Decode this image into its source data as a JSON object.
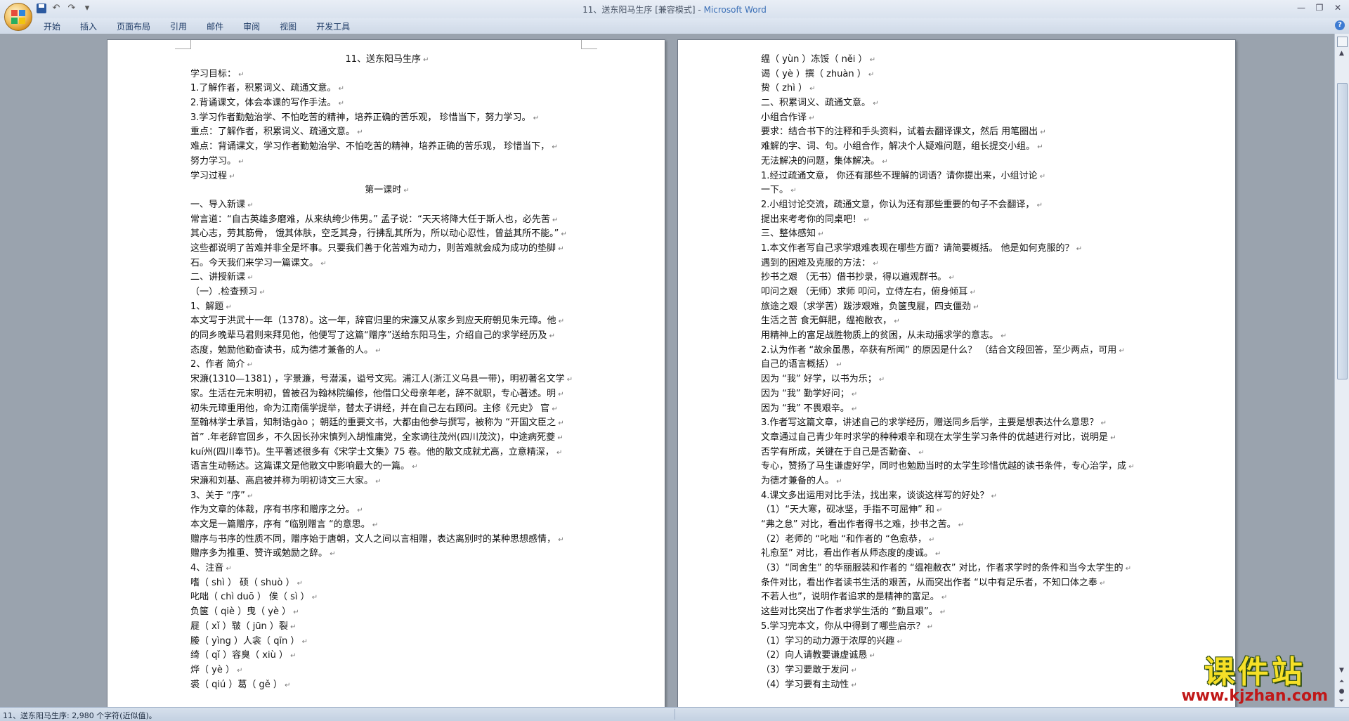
{
  "window": {
    "doc_title": "11、送东阳马生序 [兼容模式]",
    "separator": " - ",
    "app_name": "Microsoft Word"
  },
  "ribbon": {
    "tabs": [
      "开始",
      "插入",
      "页面布局",
      "引用",
      "邮件",
      "审阅",
      "视图",
      "开发工具"
    ]
  },
  "left_page": {
    "lines": [
      {
        "text": "11、送东阳马生序",
        "center": true
      },
      {
        "text": "学习目标："
      },
      {
        "text": "1.了解作者，积累词义、疏通文意。"
      },
      {
        "text": "2.背诵课文，体会本课的写作手法。"
      },
      {
        "text": "3.学习作者勤勉治学、不怕吃苦的精神，培养正确的苦乐观， 珍惜当下，努力学习。"
      },
      {
        "text": "重点：了解作者，积累词义、疏通文意。"
      },
      {
        "text": "难点：背诵课文，学习作者勤勉治学、不怕吃苦的精神，培养正确的苦乐观， 珍惜当下，"
      },
      {
        "text": "努力学习。"
      },
      {
        "text": "学习过程"
      },
      {
        "text": "第一课时",
        "center": true
      },
      {
        "text": "一、导入新课"
      },
      {
        "text": "常言道：“自古英雄多磨难，从来纨绔少伟男。” 孟子说：“天天将降大任于斯人也，必先苦"
      },
      {
        "text": "其心志，劳其筋骨，  饿其体肤，空乏其身，行拂乱其所为，所以动心忍性，曾益其所不能。”"
      },
      {
        "text": "这些都说明了苦难并非全是坏事。只要我们善于化苦难为动力，则苦难就会成为成功的垫脚"
      },
      {
        "text": "石。今天我们来学习一篇课文。"
      },
      {
        "text": "二、讲授新课"
      },
      {
        "text": "（一）.检查预习"
      },
      {
        "text": "1、解题"
      },
      {
        "text": "本文写于洪武十一年（1378）。这一年，辞官归里的宋濂又从家乡到应天府朝见朱元璋。他"
      },
      {
        "text": "的同乡晚辈马君则来拜见他，他便写了这篇“赠序”送给东阳马生，介绍自己的求学经历及"
      },
      {
        "text": "态度，勉励他勤奋读书，成为德才兼备的人。"
      },
      {
        "text": "2、作者 简介"
      },
      {
        "text": "宋濂(1310—1381) ，字景濂，号潜溪，谥号文宪。浦江人(浙江义乌县一带)，明初著名文学"
      },
      {
        "text": "家。生活在元末明初，曾被召为翰林院编修，他借口父母亲年老，辞不就职，专心著述。明"
      },
      {
        "text": "初朱元璋重用他，命为江南儒学提举，替太子讲经，并在自己左右顾问。主修《元史》 官"
      },
      {
        "text": "至翰林学士承旨，知制诰ɡào ；朝廷的重要文书，大都由他参与撰写，被称为 “开国文臣之"
      },
      {
        "text": "首” .年老辞官回乡，不久因长孙宋慎列入胡惟庸党，全家谪往茂州(四川茂汶)，中途病死夔"
      },
      {
        "text": "kuí州(四川奉节)。生平著述很多有《宋学士文集》75 卷。他的散文成就尤高，立意精深，"
      },
      {
        "text": "语言生动畅达。这篇课文是他散文中影响最大的一篇。"
      },
      {
        "text": "宋濂和刘基、高启被并称为明初诗文三大家。"
      },
      {
        "text": "3、关于 “序”"
      },
      {
        "text": "作为文章的体裁，序有书序和赠序之分。"
      },
      {
        "text": "本文是一篇赠序，序有 “临别赠言 “的意思。"
      },
      {
        "text": "赠序与书序的性质不同，赠序始于唐朝，文人之间以言相赠，表达离别时的某种思想感情，"
      },
      {
        "text": "赠序多为推重、赞许或勉励之辞。"
      },
      {
        "text": "4、注音"
      },
      {
        "text": "嗜（    shì  ）         硕（     shuò  ）"
      },
      {
        "text": "叱咄（   chì  duō  ）     俟（   sì  ）"
      },
      {
        "text": "负箧（  qiè ）曳（   yè   ）"
      },
      {
        "text": "屣（    xǐ  ）皲（ jūn ）裂"
      },
      {
        "text": " 媵（     yìng ）人衾（  qīn  ）"
      },
      {
        "text": " 绮（     qǐ  ）容臭（   xiù  ）"
      },
      {
        "text": " 烨（     yè ）"
      },
      {
        "text": "裘（    qiú ）葛（    gě  ）"
      }
    ]
  },
  "right_page": {
    "lines": [
      {
        "text": "缊（    yùn  ）冻馁（     něi  ）"
      },
      {
        "text": " 谒（   yè  ）撰（      zhuàn  ）"
      },
      {
        "text": " 贽（     zhì   ）"
      },
      {
        "text": "二、积累词义、疏通文意。"
      },
      {
        "text": "小组合作译"
      },
      {
        "text": "要求：结合书下的注释和手头资料，试着去翻译课文，然后 用笔圈出"
      },
      {
        "text": "难解的字、词、句。小组合作，解决个人疑难问题，组长提交小组。"
      },
      {
        "text": "无法解决的问题，集体解决。"
      },
      {
        "text": " 1.经过疏通文意， 你还有那些不理解的词语？请你提出来，小组讨论"
      },
      {
        "text": "一下。"
      },
      {
        "text": " 2.小组讨论交流，疏通文意，你认为还有那些重要的句子不会翻译，"
      },
      {
        "text": "提出来考考你的同桌吧！"
      },
      {
        "text": "三、整体感知"
      },
      {
        "text": "1.本文作者写自己求学艰难表现在哪些方面？请简要概括。 他是如何克服的？"
      },
      {
        "text": "  遇到的困难及克服的方法："
      },
      {
        "text": "抄书之艰 （无书）借书抄录，得以遍观群书。"
      },
      {
        "text": "叩问之艰 （无师）求师   叩问，立侍左右，俯身倾耳"
      },
      {
        "text": "旅途之艰（求学苦）跋涉艰难，负箧曳屣，四支僵劲"
      },
      {
        "text": " 生活之苦   食无鲜肥，缊袍敝衣，"
      },
      {
        "text": "   用精神上的富足战胜物质上的贫困，从未动摇求学的意志。"
      },
      {
        "text": "2.认为作者 “故余虽愚，卒获有所闻” 的原因是什么？ （结合文段回答，至少两点，可用"
      },
      {
        "text": "自己的语言概括）"
      },
      {
        "text": "因为 “我” 好学，以书为乐；"
      },
      {
        "text": "因为 “我” 勤学好问；"
      },
      {
        "text": "因为 “我” 不畏艰辛。"
      },
      {
        "text": "3.作者写这篇文章，讲述自己的求学经历，赠送同乡后学，主要是想表达什么意思？"
      },
      {
        "text": "    文章通过自己青少年时求学的种种艰辛和现在太学生学习条件的优越进行对比，说明是"
      },
      {
        "text": "否学有所成，关键在于自己是否勤奋、"
      },
      {
        "text": "专心，赞扬了马生谦虚好学，同时也勉励当时的太学生珍惜优越的读书条件，专心治学，成"
      },
      {
        "text": "为德才兼备的人。"
      },
      {
        "text": "4.课文多出运用对比手法，找出来，谈谈这样写的好处？"
      },
      {
        "text": "（1）“天大寒，砚冰坚，手指不可屈伸” 和"
      },
      {
        "text": "“弗之怠” 对比，看出作者得书之难，抄书之苦。"
      },
      {
        "text": "（2）老师的 “叱咄 “和作者的 “色愈恭，"
      },
      {
        "text": "礼愈至” 对比，看出作者从师态度的虔诚。"
      },
      {
        "text": "（3）“同舍生” 的华丽服装和作者的 “缊袍敝衣” 对比，作者求学时的条件和当今太学生的"
      },
      {
        "text": "条件对比，看出作者读书生活的艰苦，从而突出作者 “以中有足乐者，不知口体之奉"
      },
      {
        "text": "不若人也”，说明作者追求的是精神的富足。"
      },
      {
        "text": "这些对比突出了作者求学生活的 “勤且艰”。"
      },
      {
        "text": "5.学习完本文，你从中得到了哪些启示？"
      },
      {
        "text": "（1）学习的动力源于浓厚的兴趣"
      },
      {
        "text": "（2）向人请教要谦虚诚恳"
      },
      {
        "text": "（3）学习要敢于发问"
      },
      {
        "text": "（4）学习要有主动性"
      }
    ]
  },
  "status": {
    "text": "11、送东阳马生序: 2,980 个字符(近似值)。"
  },
  "watermark": {
    "main": "课件站",
    "url": "www.kjzhan.com"
  },
  "icons": {
    "office_button": "office-logo-icon",
    "save": "save-icon",
    "undo": "undo-icon",
    "redo": "redo-icon",
    "help": "help-icon"
  },
  "colors": {
    "app_name": "#3b6fb6",
    "page_bg": "#ffffff",
    "workspace_bg": "#9aa3ae",
    "watermark_main": "#f6e027",
    "watermark_url": "#c01818"
  }
}
